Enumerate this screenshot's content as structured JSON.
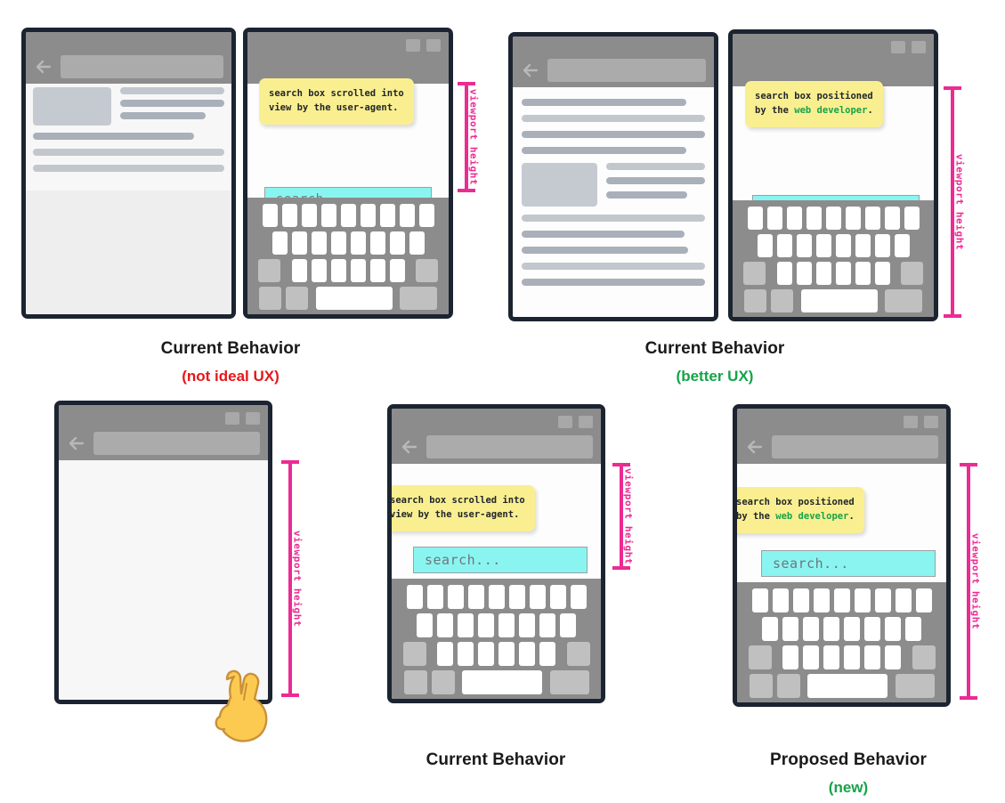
{
  "meta": {
    "colors": {
      "pink": "#ec2b93",
      "cyan": "#8af5f0",
      "tooltip_yellow": "#faef90",
      "green": "#16a34a",
      "red": "#e8161b",
      "frame_dark": "#1b2430",
      "chrome_gray": "#8c8c8c"
    }
  },
  "search": {
    "placeholder": "search..."
  },
  "bracket_label": "viewport height",
  "tooltips": {
    "scrolled": {
      "line1": "search box scrolled into",
      "line2": "view by the user-agent."
    },
    "positioned": {
      "line1": "search box positioned",
      "line2_pre": "by the ",
      "line2_hl": "web developer",
      "line2_post": "."
    }
  },
  "icons": {
    "back": "back-arrow-icon",
    "hand": "pointing-hand-icon",
    "window_controls": [
      "window-button-1",
      "window-button-2"
    ]
  },
  "panels": [
    {
      "id": "top-left-group",
      "caption_main": "Current Behavior",
      "caption_sub": "(not ideal UX)",
      "caption_sub_color": "red"
    },
    {
      "id": "top-right-group",
      "caption_main": "Current Behavior",
      "caption_sub": "(better UX)",
      "caption_sub_color": "green"
    },
    {
      "id": "bottom-middle",
      "caption_main": "Current Behavior",
      "caption_sub": "",
      "caption_sub_color": ""
    },
    {
      "id": "bottom-right",
      "caption_main": "Proposed  Behavior",
      "caption_sub": "(new)",
      "caption_sub_color": "green"
    }
  ],
  "keyboard": {
    "row1_keys": 9,
    "row2_keys": 8,
    "row3_keys": 6,
    "row4_label": "space"
  }
}
